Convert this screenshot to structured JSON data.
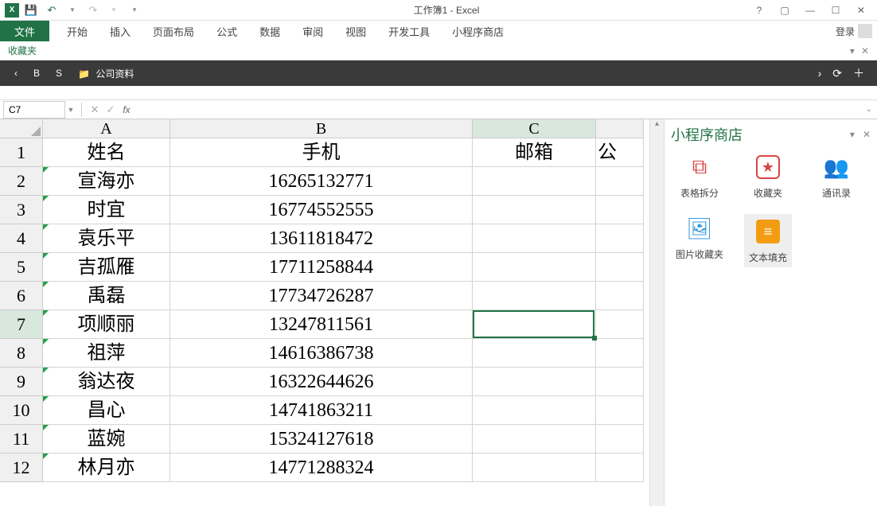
{
  "titlebar": {
    "title": "工作簿1 - Excel"
  },
  "ribbon": {
    "file": "文件",
    "tabs": [
      "开始",
      "插入",
      "页面布局",
      "公式",
      "数据",
      "审阅",
      "视图",
      "开发工具",
      "小程序商店"
    ],
    "login": "登录"
  },
  "favbar": {
    "label": "收藏夹"
  },
  "darkbar": {
    "items": [
      "B",
      "S"
    ],
    "folder": "公司资料"
  },
  "formula": {
    "name_box": "C7"
  },
  "columns": [
    "A",
    "B",
    "C"
  ],
  "partial_col_d": "公",
  "headers": {
    "A": "姓名",
    "B": "手机",
    "C": "邮箱"
  },
  "rows": [
    {
      "n": "1",
      "A": "姓名",
      "B": "手机",
      "C": "邮箱",
      "D": "公"
    },
    {
      "n": "2",
      "A": "宣海亦",
      "B": "16265132771",
      "C": "",
      "D": ""
    },
    {
      "n": "3",
      "A": "时宜",
      "B": "16774552555",
      "C": "",
      "D": ""
    },
    {
      "n": "4",
      "A": "袁乐平",
      "B": "13611818472",
      "C": "",
      "D": ""
    },
    {
      "n": "5",
      "A": "吉孤雁",
      "B": "17711258844",
      "C": "",
      "D": ""
    },
    {
      "n": "6",
      "A": "禹磊",
      "B": "17734726287",
      "C": "",
      "D": ""
    },
    {
      "n": "7",
      "A": "项顺丽",
      "B": "13247811561",
      "C": "",
      "D": ""
    },
    {
      "n": "8",
      "A": "祖萍",
      "B": "14616386738",
      "C": "",
      "D": ""
    },
    {
      "n": "9",
      "A": "翁达夜",
      "B": "16322644626",
      "C": "",
      "D": ""
    },
    {
      "n": "10",
      "A": "昌心",
      "B": "14741863211",
      "C": "",
      "D": ""
    },
    {
      "n": "11",
      "A": "蓝婉",
      "B": "15324127618",
      "C": "",
      "D": ""
    },
    {
      "n": "12",
      "A": "林月亦",
      "B": "14771288324",
      "C": "",
      "D": ""
    }
  ],
  "active_cell": "C7",
  "panel": {
    "title": "小程序商店",
    "apps": [
      {
        "label": "表格拆分",
        "icon": "split"
      },
      {
        "label": "收藏夹",
        "icon": "fav"
      },
      {
        "label": "通讯录",
        "icon": "contact"
      },
      {
        "label": "图片收藏夹",
        "icon": "pic"
      },
      {
        "label": "文本填充",
        "icon": "text",
        "selected": true
      }
    ]
  }
}
